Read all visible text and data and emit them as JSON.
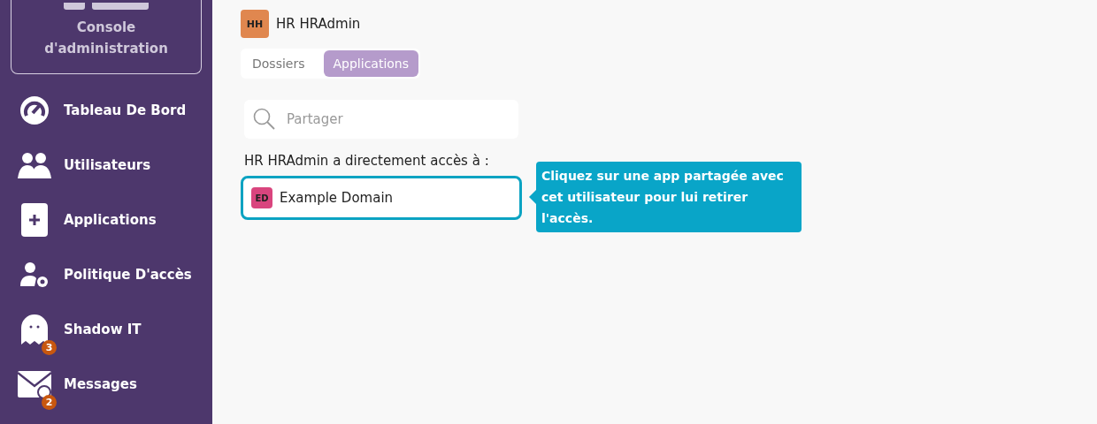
{
  "sidebar": {
    "console_label": "Console d'administration",
    "items": [
      {
        "kind": "gauge",
        "label": "Tableau De Bord"
      },
      {
        "kind": "users",
        "label": "Utilisateurs"
      },
      {
        "kind": "plus",
        "label": "Applications"
      },
      {
        "kind": "usergear",
        "label": "Politique D'accès"
      },
      {
        "kind": "ghost",
        "label": "Shadow IT",
        "badge": "3"
      },
      {
        "kind": "mail",
        "label": "Messages",
        "badge": "2"
      }
    ]
  },
  "user": {
    "initials": "HH",
    "name": "HR HRAdmin"
  },
  "tabs": [
    {
      "label": "Dossiers",
      "selected": false
    },
    {
      "label": "Applications",
      "selected": true
    }
  ],
  "search": {
    "placeholder": "Partager"
  },
  "access_heading": "HR HRAdmin a directement accès à :",
  "apps": [
    {
      "initials": "ED",
      "name": "Example Domain",
      "color": "#d9457e"
    }
  ],
  "tooltip": "Cliquez sur une app partagée avec cet utilisateur pour lui retirer l'accès."
}
